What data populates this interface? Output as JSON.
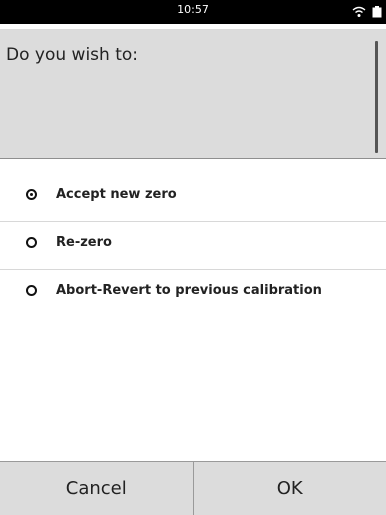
{
  "status_bar": {
    "time": "10:57",
    "icons": [
      "wifi-icon",
      "battery-icon"
    ]
  },
  "dialog": {
    "prompt": "Do you wish to:",
    "options": [
      {
        "label": "Accept new zero",
        "selected": true
      },
      {
        "label": "Re-zero",
        "selected": false
      },
      {
        "label": "Abort-Revert to previous calibration",
        "selected": false
      }
    ],
    "buttons": {
      "cancel": "Cancel",
      "ok": "OK"
    }
  },
  "colors": {
    "status_bar_bg": "#000000",
    "panel_bg": "#dcdcdc",
    "text": "#222222"
  }
}
